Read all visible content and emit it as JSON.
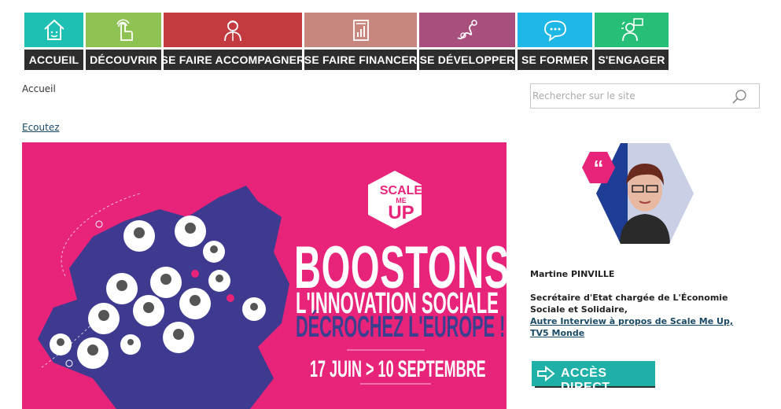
{
  "nav": {
    "items": [
      {
        "label": "ACCUEIL",
        "color": "#1ec0b4",
        "icon": "house-icon"
      },
      {
        "label": "DÉCOUVRIR",
        "color": "#8ec253",
        "icon": "pointing-hand-icon"
      },
      {
        "label": "SE FAIRE ACCOMPAGNER",
        "color": "#c43a41",
        "icon": "mentor-icon"
      },
      {
        "label": "SE FAIRE FINANCER",
        "color": "#c7877f",
        "icon": "document-chart-icon"
      },
      {
        "label": "SE DÉVELOPPER",
        "color": "#a84f7d",
        "icon": "growth-swirl-icon"
      },
      {
        "label": "SE FORMER",
        "color": "#1fb7e5",
        "icon": "chat-bubble-icon"
      },
      {
        "label": "S'ENGAGER",
        "color": "#27bf78",
        "icon": "engaged-person-icon"
      }
    ]
  },
  "breadcrumb": "Accueil",
  "listen_link": "Ecoutez",
  "search": {
    "placeholder": "Rechercher sur le site"
  },
  "banner": {
    "badge_line1": "SCALE",
    "badge_line2": "ME",
    "badge_line3": "UP",
    "title": "BOOSTONS",
    "subtitle": "L'INNOVATION SOCIALE",
    "subtitle2": "DÉCROCHEZ L'EUROPE !",
    "dates_start": "17 JUIN",
    "dates_end": "10 SEPTEMBRE",
    "colors": {
      "background": "#e8237a",
      "map": "#3d3a8f"
    }
  },
  "testimonial": {
    "name": "Martine  PINVILLE",
    "role": "Secrétaire d'Etat chargée de L'Économie Sociale et Solidaire,",
    "link1": "Autre Interview à propos de Scale Me Up,",
    "link2": "TV5 Monde "
  },
  "access_button": {
    "label": "ACCÈS DIRECT",
    "color": "#1fb0a8"
  }
}
